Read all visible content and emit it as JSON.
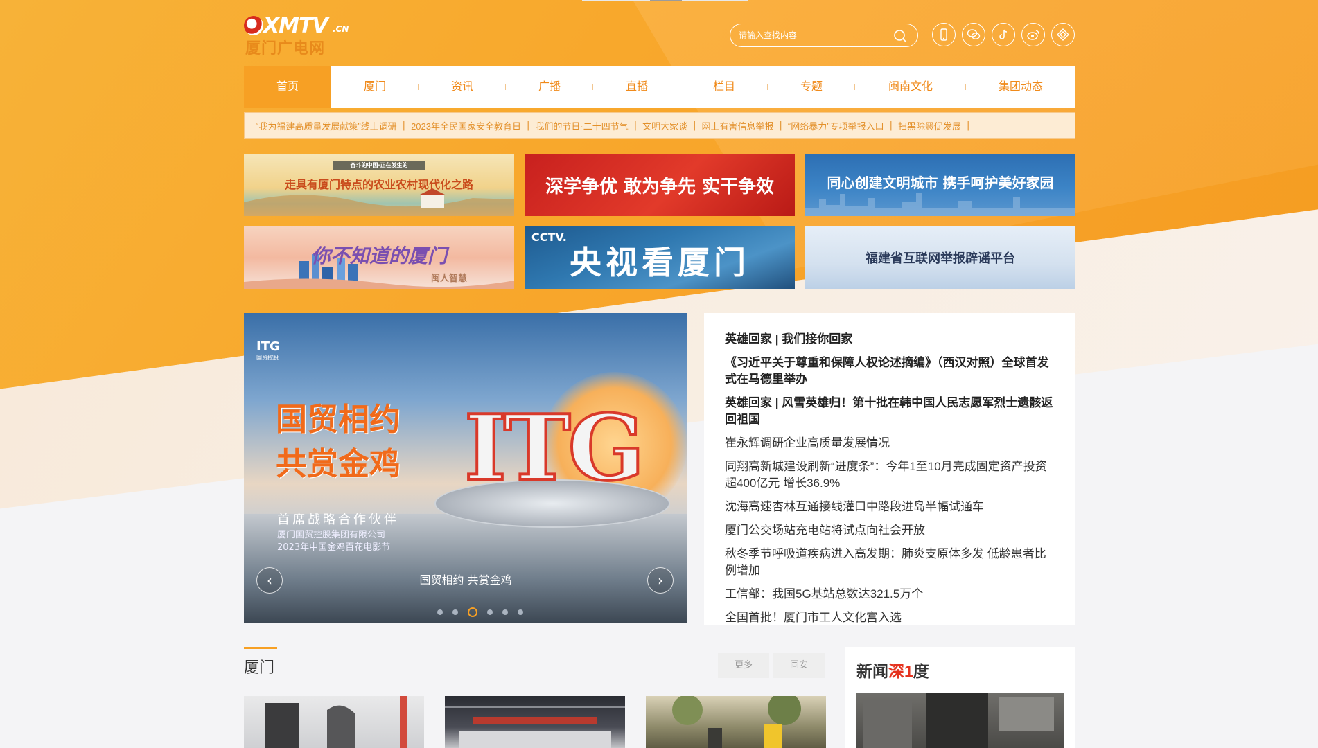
{
  "site": {
    "logo_main": "XMTV",
    "logo_domain": ".CN",
    "logo_sub": "厦门广电网"
  },
  "search": {
    "placeholder": "请输入查找内容"
  },
  "social_icons": [
    "phone-icon",
    "wechat-icon",
    "tiktok-icon",
    "weibo-icon",
    "app-icon"
  ],
  "nav": {
    "items": [
      {
        "label": "首页",
        "active": true
      },
      {
        "label": "厦门"
      },
      {
        "label": "资讯"
      },
      {
        "label": "广播"
      },
      {
        "label": "直播"
      },
      {
        "label": "栏目"
      },
      {
        "label": "专题"
      },
      {
        "label": "闽南文化"
      },
      {
        "label": "集团动态"
      }
    ]
  },
  "ticker": [
    "“我为福建高质量发展献策”线上调研",
    "2023年全民国家安全教育日",
    "我们的节日·二十四节气",
    "文明大家谈",
    "网上有害信息举报",
    "“网络暴力”专项举报入口",
    "扫黑除恶促发展"
  ],
  "banners": [
    {
      "text": "走具有厦门特点的农业农村现代化之路",
      "tag": "奋斗的中国·正在发生的"
    },
    {
      "text": "深学争优 敢为争先 实干争效"
    },
    {
      "text": "同心创建文明城市 携手呵护美好家园"
    },
    {
      "text": "你不知道的厦门",
      "tag": "闽人智慧"
    },
    {
      "text": "央视看厦门",
      "tag": "CCTV."
    },
    {
      "text": "福建省互联网举报辟谣平台"
    }
  ],
  "hero": {
    "brand": "ITG",
    "brand_sub": "国贸控股",
    "slogan_line1": "国贸相约",
    "slogan_line2": "共赏金鸡",
    "big_text": "ITG",
    "sub_title": "首席战略合作伙伴",
    "sub_line1": "厦门国贸控股集团有限公司",
    "sub_line2": "2023年中国金鸡百花电影节",
    "caption": "国贸相约 共赏金鸡",
    "slide_count": 6,
    "active_slide": 3
  },
  "headlines": [
    {
      "text": "英雄回家 | 我们接你回家",
      "bold": true
    },
    {
      "text": "《习近平关于尊重和保障人权论述摘编》（西汉对照）全球首发式在马德里举办",
      "bold": true
    },
    {
      "text": "英雄回家 | 风雪英雄归！第十批在韩中国人民志愿军烈士遗骸返回祖国",
      "bold": true
    },
    {
      "text": "崔永辉调研企业高质量发展情况"
    },
    {
      "text": "同翔高新城建设刷新“进度条”：今年1至10月完成固定资产投资超400亿元 增长36.9%"
    },
    {
      "text": "沈海高速杏林互通接线灌口中路段进岛半幅试通车"
    },
    {
      "text": "厦门公交场站充电站将试点向社会开放"
    },
    {
      "text": "秋冬季节呼吸道疾病进入高发期：肺炎支原体多发 低龄患者比例增加"
    },
    {
      "text": "工信部：我国5G基站总数达321.5万个"
    },
    {
      "text": "全国首批！厦门市工人文化宫入选"
    }
  ],
  "section": {
    "title": "厦门",
    "more_label": "更多",
    "tab_label": "同安"
  },
  "deep": {
    "title_pre": "新闻",
    "title_accent": "深1",
    "title_post": "度"
  },
  "colors": {
    "accent": "#f7a024",
    "nav_text": "#f08a1a",
    "red": "#d9392a"
  }
}
